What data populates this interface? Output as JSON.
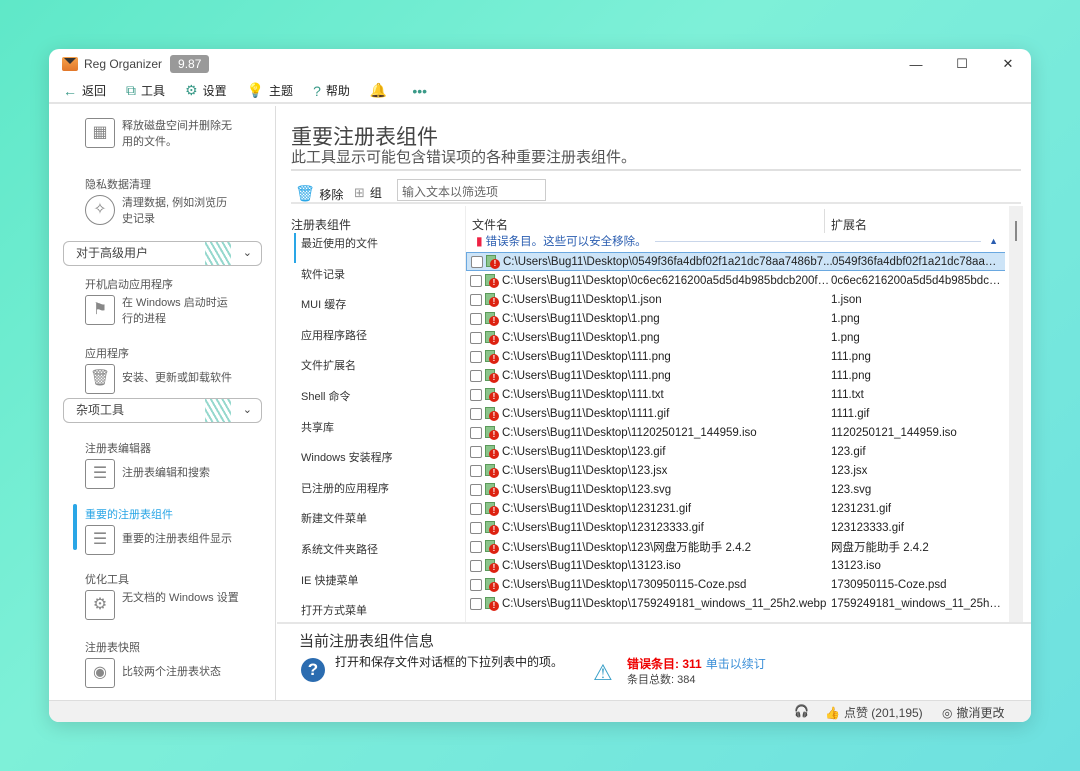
{
  "app": {
    "title": "Reg Organizer",
    "version": "9.87"
  },
  "window_controls": {
    "minimize": "—",
    "maximize": "☐",
    "close": "✕"
  },
  "toolbar": [
    {
      "icon": "back-arrow-icon",
      "glyph": "←",
      "label": "返回"
    },
    {
      "icon": "toolbox-icon",
      "glyph": "⧉",
      "label": "工具"
    },
    {
      "icon": "gear-icon",
      "glyph": "⚙",
      "label": "设置"
    },
    {
      "icon": "lightbulb-icon",
      "glyph": "💡",
      "label": "主题"
    },
    {
      "icon": "help-icon",
      "glyph": "?",
      "label": "帮助"
    },
    {
      "icon": "bell-icon",
      "glyph": "🔔",
      "label": ""
    },
    {
      "icon": "more-icon",
      "glyph": "•••",
      "label": ""
    }
  ],
  "sidebar": {
    "items": [
      {
        "title": "",
        "desc": "释放磁盘空间并删除无用的文件。",
        "icon": "disk-cleanup-icon"
      },
      {
        "title": "隐私数据清理",
        "desc": "清理数据, 例如浏览历史记录",
        "icon": "privacy-cleanup-icon"
      },
      {
        "title": "开机启动应用程序",
        "desc": "在 Windows 启动时运行的进程",
        "icon": "startup-flag-icon"
      },
      {
        "title": "应用程序",
        "desc": "安装、更新或卸载软件",
        "icon": "uninstall-box-icon"
      },
      {
        "title": "注册表编辑器",
        "desc": "注册表编辑和搜索",
        "icon": "registry-editor-icon"
      },
      {
        "title": "重要的注册表组件",
        "desc": "重要的注册表组件显示",
        "icon": "registry-cleanup-icon",
        "active": true
      },
      {
        "title": "优化工具",
        "desc": "无文档的 Windows 设置",
        "icon": "windows-tweaks-icon"
      },
      {
        "title": "注册表快照",
        "desc": "比较两个注册表状态",
        "icon": "registry-snapshot-icon"
      }
    ],
    "groups": [
      "对于高级用户",
      "杂项工具"
    ]
  },
  "main": {
    "title": "重要注册表组件",
    "subtitle": "此工具显示可能包含错误项的各种重要注册表组件。",
    "actions": {
      "remove": "移除",
      "group": "组"
    },
    "filter_placeholder": "输入文本以筛选项",
    "categories_header": "注册表组件",
    "categories": [
      "最近使用的文件",
      "软件记录",
      "MUI 缓存",
      "应用程序路径",
      "文件扩展名",
      "Shell 命令",
      "共享库",
      "Windows 安装程序",
      "已注册的应用程序",
      "新建文件菜单",
      "系统文件夹路径",
      "IE 快捷菜单",
      "打开方式菜单"
    ],
    "columns": [
      "文件名",
      "扩展名"
    ],
    "group_label": "错误条目。这些可以安全移除。",
    "rows": [
      [
        "C:\\Users\\Bug11\\Desktop\\0549f36fa4dbf02f1a21dc78aa7486b7...",
        "0549f36fa4dbf02f1a21dc78aa74..."
      ],
      [
        "C:\\Users\\Bug11\\Desktop\\0c6ec6216200a5d5d4b985bdcb200f4...",
        "0c6ec6216200a5d5d4b985bdcb..."
      ],
      [
        "C:\\Users\\Bug11\\Desktop\\1.json",
        "1.json"
      ],
      [
        "C:\\Users\\Bug11\\Desktop\\1.png",
        "1.png"
      ],
      [
        "C:\\Users\\Bug11\\Desktop\\1.png",
        "1.png"
      ],
      [
        "C:\\Users\\Bug11\\Desktop\\111.png",
        "111.png"
      ],
      [
        "C:\\Users\\Bug11\\Desktop\\111.png",
        "111.png"
      ],
      [
        "C:\\Users\\Bug11\\Desktop\\111.txt",
        "111.txt"
      ],
      [
        "C:\\Users\\Bug11\\Desktop\\1111.gif",
        "1111.gif"
      ],
      [
        "C:\\Users\\Bug11\\Desktop\\1120250121_144959.iso",
        "1120250121_144959.iso"
      ],
      [
        "C:\\Users\\Bug11\\Desktop\\123.gif",
        "123.gif"
      ],
      [
        "C:\\Users\\Bug11\\Desktop\\123.jsx",
        "123.jsx"
      ],
      [
        "C:\\Users\\Bug11\\Desktop\\123.svg",
        "123.svg"
      ],
      [
        "C:\\Users\\Bug11\\Desktop\\1231231.gif",
        "1231231.gif"
      ],
      [
        "C:\\Users\\Bug11\\Desktop\\123123333.gif",
        "123123333.gif"
      ],
      [
        "C:\\Users\\Bug11\\Desktop\\123\\网盘万能助手 2.4.2",
        "网盘万能助手 2.4.2"
      ],
      [
        "C:\\Users\\Bug11\\Desktop\\13123.iso",
        "13123.iso"
      ],
      [
        "C:\\Users\\Bug11\\Desktop\\1730950115-Coze.psd",
        "1730950115-Coze.psd"
      ],
      [
        "C:\\Users\\Bug11\\Desktop\\1759249181_windows_11_25h2.webp",
        "1759249181_windows_11_25h2...."
      ]
    ]
  },
  "info": {
    "title": "当前注册表组件信息",
    "description": "打开和保存文件对话框的下拉列表中的项。",
    "error_label": "错误条目:",
    "error_count": "311",
    "fix_link": "单击以续订",
    "total": "条目总数: 384"
  },
  "status": {
    "likes": "点赞 (201,195)",
    "undo": "撤消更改"
  },
  "colors": {
    "accent": "#2aa6e6",
    "error": "#e00000",
    "link": "#3b8fd8",
    "toolbar_icon": "#3a9a88"
  }
}
